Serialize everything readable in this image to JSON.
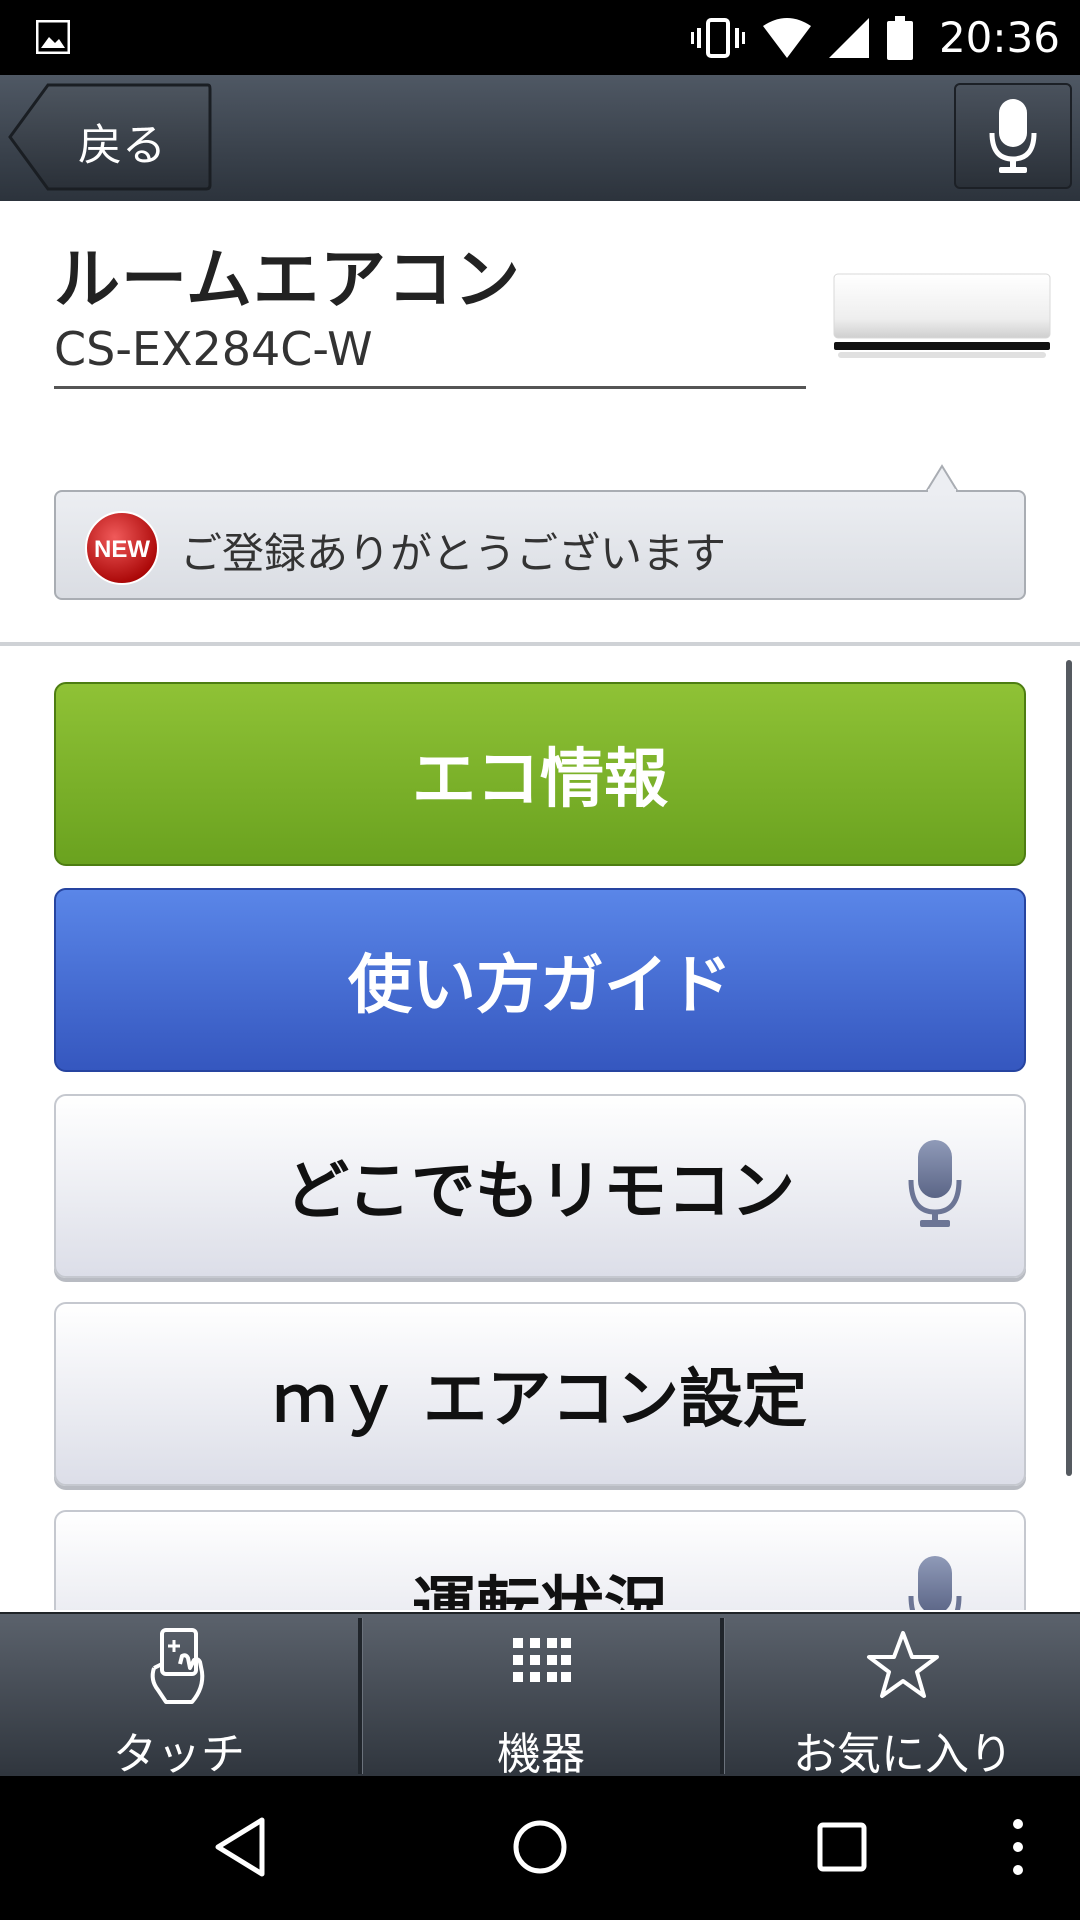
{
  "status_bar": {
    "time": "20:36",
    "icons": [
      "gallery-icon",
      "vibrate-icon",
      "wifi-icon",
      "signal-icon",
      "battery-icon"
    ]
  },
  "action_bar": {
    "back_label": "戻る",
    "mic_icon": "microphone-icon"
  },
  "device": {
    "name": "ルームエアコン",
    "model": "CS-EX284C-W"
  },
  "notification": {
    "badge": "NEW",
    "text": "ご登録ありがとうございます"
  },
  "menu": {
    "items": [
      {
        "label": "エコ情報"
      },
      {
        "label": "使い方ガイド"
      },
      {
        "label": "どこでもリモコン",
        "voice": true
      },
      {
        "label": "ｍｙ エアコン設定"
      },
      {
        "label": "運転状況",
        "voice": true
      }
    ]
  },
  "tabs": [
    {
      "label": "タッチ",
      "icon": "touch-hand-icon"
    },
    {
      "label": "機器",
      "icon": "grid-icon"
    },
    {
      "label": "お気に入り",
      "icon": "star-icon"
    }
  ],
  "colors": {
    "eco_green": "#7cb229",
    "guide_blue": "#4670d6",
    "bar_dark": "#2c333c"
  }
}
